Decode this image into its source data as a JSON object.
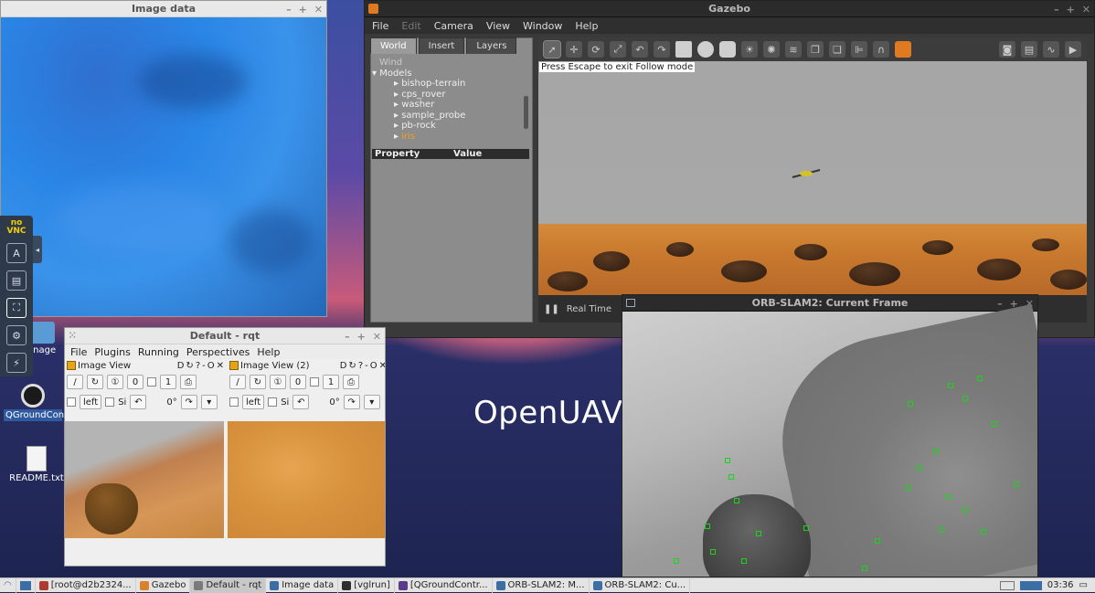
{
  "desktop": {
    "brand": "OpenUAV",
    "icons": [
      {
        "label": "QGroundControl"
      },
      {
        "label": "README.txt"
      },
      {
        "label": "anage"
      }
    ]
  },
  "image_data_window": {
    "title": "Image data"
  },
  "gazebo": {
    "title": "Gazebo",
    "menu": [
      "File",
      "Edit",
      "Camera",
      "View",
      "Window",
      "Help"
    ],
    "tabs": [
      "World",
      "Insert",
      "Layers"
    ],
    "tree": {
      "wind": "Wind",
      "models": "Models",
      "items": [
        "bishop-terrain",
        "cps_rover",
        "washer",
        "sample_probe",
        "pb-rock",
        "iris"
      ]
    },
    "props": {
      "property": "Property",
      "value": "Value"
    },
    "hint": "Press Escape to exit Follow mode",
    "bottom": {
      "realtime": "Real Time"
    }
  },
  "rqt": {
    "title": "Default - rqt",
    "menu": [
      "File",
      "Plugins",
      "Running",
      "Perspectives",
      "Help"
    ],
    "panels": [
      {
        "title": "Image View",
        "topic": "/",
        "spin1": "0",
        "spin2": "1",
        "check_label": "left",
        "angle": "0°",
        "ctrl": "D",
        "help": "?",
        "minus": "-",
        "o": "O",
        "x": "✕"
      },
      {
        "title": "Image View (2)",
        "topic": "/",
        "spin1": "0",
        "spin2": "1",
        "check_label": "left",
        "angle": "0°",
        "ctrl": "D",
        "help": "?",
        "minus": "-",
        "o": "O",
        "x": "✕"
      }
    ],
    "small_label": "Si"
  },
  "orb": {
    "title": "ORB-SLAM2: Current Frame"
  },
  "vnc": {
    "logo_top": "no",
    "logo_bottom": "VNC"
  },
  "taskbar": {
    "tasks": [
      {
        "label": "[root@d2b2324...",
        "color": "#b03a2e"
      },
      {
        "label": "Gazebo",
        "color": "#d9822b"
      },
      {
        "label": "Default - rqt",
        "color": "#7a7a7a"
      },
      {
        "label": "Image data",
        "color": "#3a6ea5"
      },
      {
        "label": "[vglrun]",
        "color": "#2e2e2e"
      },
      {
        "label": "[QGroundContr...",
        "color": "#5a3a8a"
      },
      {
        "label": "ORB-SLAM2: M...",
        "color": "#3a6ea5"
      },
      {
        "label": "ORB-SLAM2: Cu...",
        "color": "#3a6ea5"
      }
    ],
    "clock": "03:36"
  }
}
